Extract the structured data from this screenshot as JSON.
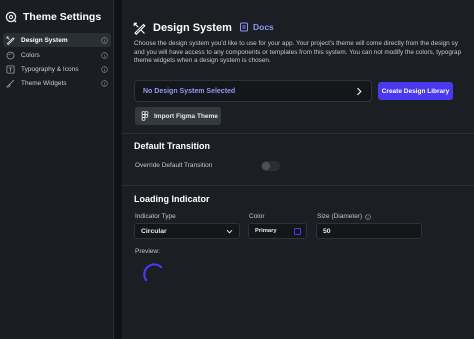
{
  "sidebar": {
    "title": "Theme Settings",
    "items": [
      {
        "label": "Design System",
        "icon": "pencil-ruler-icon",
        "active": true
      },
      {
        "label": "Colors",
        "icon": "palette-icon",
        "active": false
      },
      {
        "label": "Typography & Icons",
        "icon": "typography-icon",
        "active": false
      },
      {
        "label": "Theme Widgets",
        "icon": "brush-icon",
        "active": false
      }
    ]
  },
  "main": {
    "title": "Design System",
    "docs_label": "Docs",
    "description": [
      "Choose the design system you'd like to use for your app. Your project's theme will come directly from the design sy",
      "and you will have access to any components or templates from this system. You can not modify the colors, typograp",
      "theme widgets when a design system is chosen."
    ],
    "design_system_select": "No Design System Selected",
    "create_button": "Create Design Library",
    "figma_button": "Import Figma Theme",
    "default_transition": {
      "title": "Default Transition",
      "override_label": "Override Default Transition",
      "override_enabled": false
    },
    "loading_indicator": {
      "title": "Loading Indicator",
      "type_label": "Indicator Type",
      "type_value": "Circular",
      "color_label": "Color",
      "color_value": "Primary",
      "size_label": "Size (Diameter)",
      "size_value": "50",
      "preview_label": "Preview:"
    }
  },
  "colors": {
    "accent": "#4b39ef",
    "accent_text": "#8f97f7",
    "background": "#1b1e22",
    "sidebar_bg": "#1a1d21"
  }
}
